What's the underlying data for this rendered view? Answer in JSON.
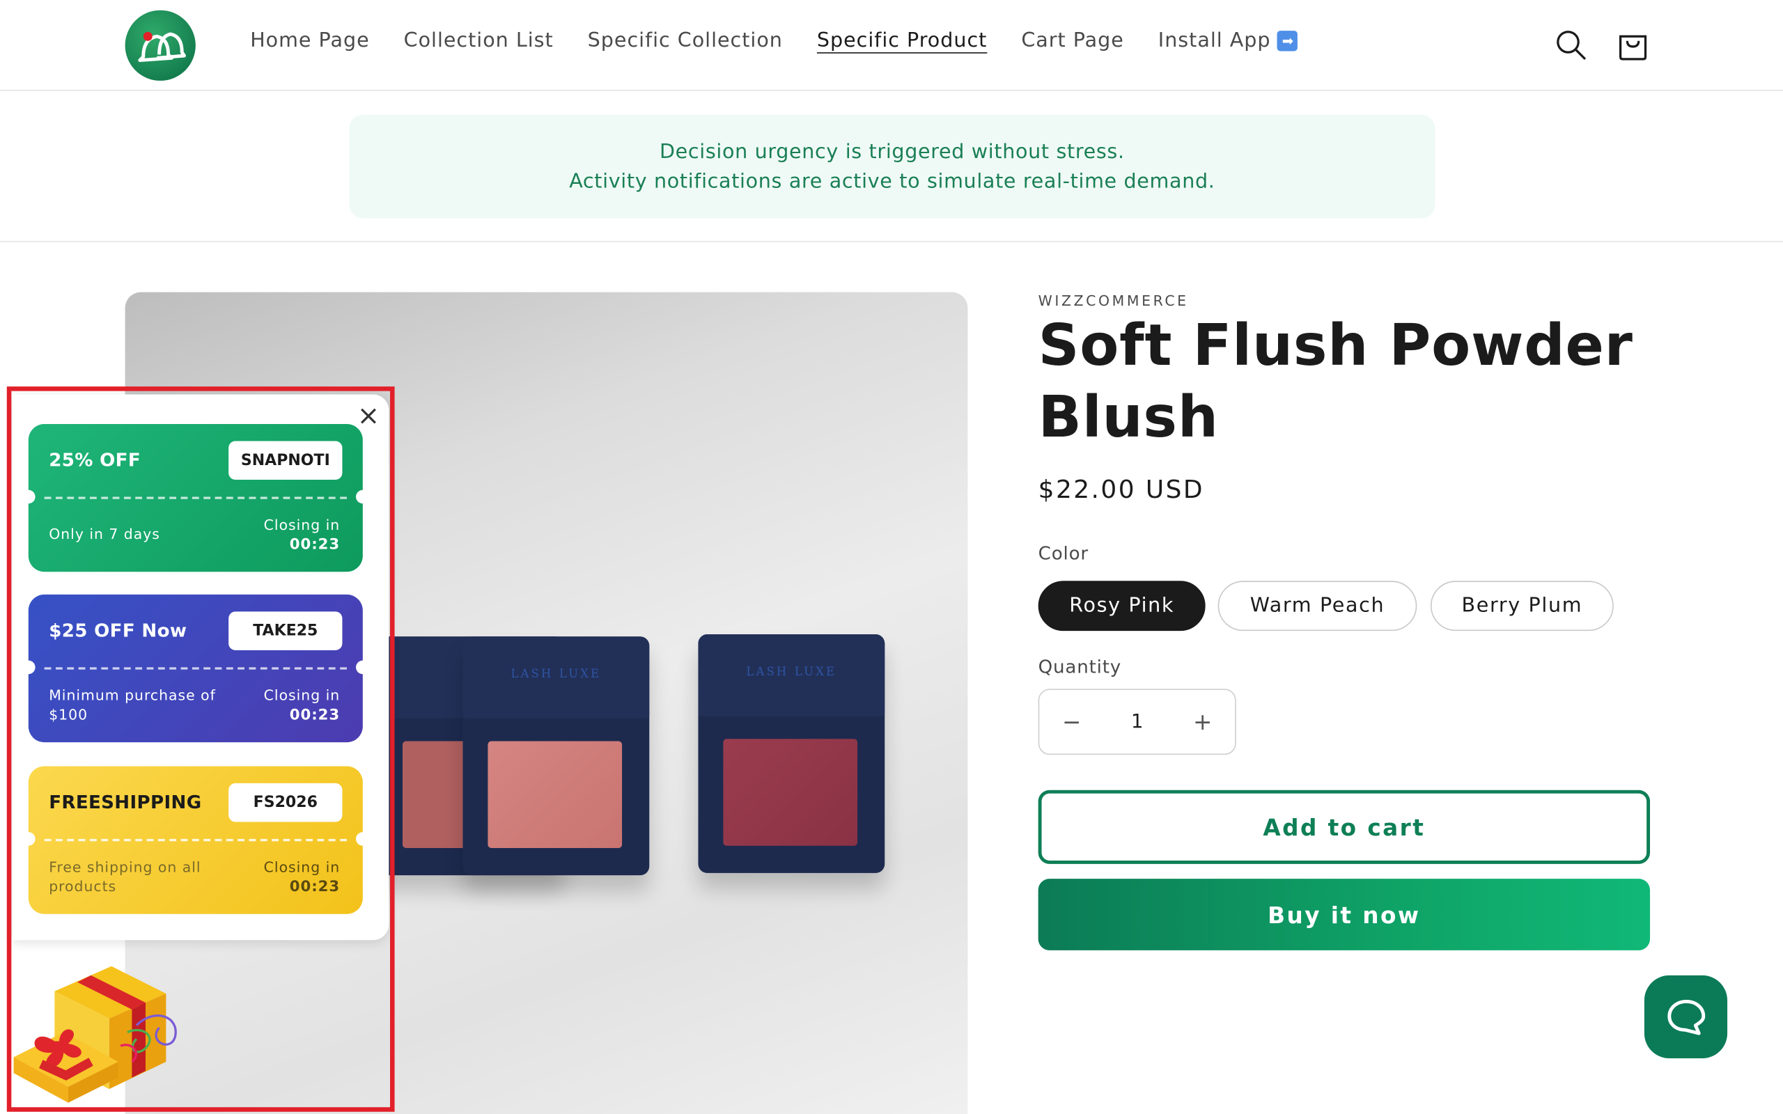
{
  "nav": {
    "items": [
      {
        "label": "Home Page"
      },
      {
        "label": "Collection List"
      },
      {
        "label": "Specific Collection"
      },
      {
        "label": "Specific Product",
        "active": true
      },
      {
        "label": "Cart Page"
      },
      {
        "label": "Install App"
      }
    ],
    "icons": [
      "logo-bells-icon",
      "search-icon",
      "cart-icon"
    ]
  },
  "banner": {
    "line1": "Decision urgency is triggered without stress.",
    "line2": "Activity notifications are active to simulate real-time demand."
  },
  "product": {
    "vendor": "WIZZCOMMERCE",
    "title": "Soft Flush Powder Blush",
    "price": "$22.00 USD",
    "color_label": "Color",
    "colors": [
      {
        "label": "Rosy Pink",
        "selected": true
      },
      {
        "label": "Warm Peach",
        "selected": false
      },
      {
        "label": "Berry Plum",
        "selected": false
      }
    ],
    "quantity_label": "Quantity",
    "quantity": "1",
    "decrement": "−",
    "increment": "+",
    "add_to_cart": "Add to cart",
    "buy_now": "Buy it now",
    "image_brand": "LASH LUXE"
  },
  "coupons": [
    {
      "title": "25% OFF",
      "code": "SNAPNOTI",
      "desc": "Only in 7 days",
      "closing_label": "Closing in",
      "time": "00:23",
      "color": "#13a86a"
    },
    {
      "title": "$25 OFF Now",
      "code": "TAKE25",
      "desc": "Minimum purchase of $100",
      "closing_label": "Closing in",
      "time": "00:23",
      "color": "#3e4bbd"
    },
    {
      "title": "FREESHIPPING",
      "code": "FS2026",
      "desc": "Free shipping on all products",
      "closing_label": "Closing in",
      "time": "00:23",
      "color": "#f6cc2c"
    }
  ],
  "colors": {
    "accent": "#0e7f56",
    "banner_bg": "#effaf6",
    "highlight_border": "#e2202a"
  }
}
